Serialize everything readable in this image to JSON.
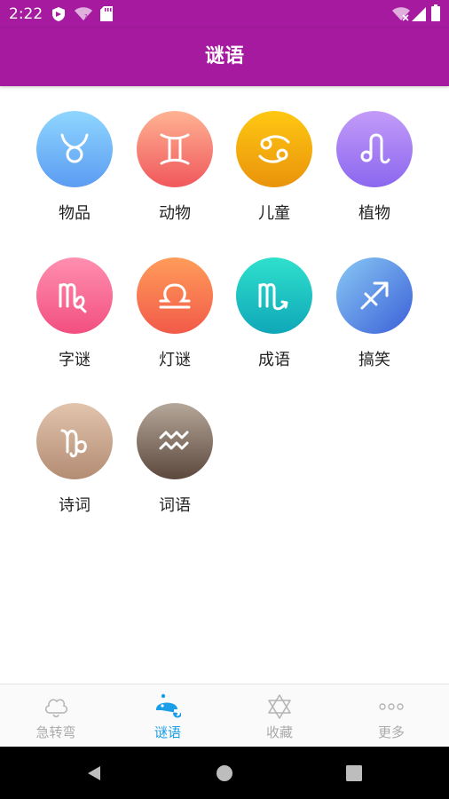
{
  "status_bar": {
    "time": "2:22",
    "left_icons": [
      "shield-icon",
      "wifi-question-icon",
      "sd-card-icon"
    ],
    "right_icons": [
      "wifi-off-icon",
      "signal-icon",
      "battery-icon"
    ]
  },
  "app_bar": {
    "title": "谜语"
  },
  "categories": [
    {
      "label": "物品",
      "icon": "taurus-icon",
      "gradient": [
        "#8fd6ff",
        "#5b9cf2"
      ]
    },
    {
      "label": "动物",
      "icon": "gemini-icon",
      "gradient": [
        "#ffb393",
        "#f0575c"
      ]
    },
    {
      "label": "儿童",
      "icon": "cancer-icon",
      "gradient": [
        "#ffc812",
        "#e9930b"
      ]
    },
    {
      "label": "植物",
      "icon": "leo-icon",
      "gradient": [
        "#c39bf8",
        "#8b67ef"
      ]
    },
    {
      "label": "字谜",
      "icon": "virgo-icon",
      "gradient": [
        "#ff8fb0",
        "#f24f7f"
      ]
    },
    {
      "label": "灯谜",
      "icon": "libra-icon",
      "gradient": [
        "#ff9c5a",
        "#f25a49"
      ]
    },
    {
      "label": "成语",
      "icon": "scorpio-icon",
      "gradient": [
        "#2fe0cc",
        "#0fa7b8"
      ]
    },
    {
      "label": "搞笑",
      "icon": "sagittarius-icon",
      "gradient": [
        "#89c9f4",
        "#3b5fd8"
      ]
    },
    {
      "label": "诗词",
      "icon": "capricorn-icon",
      "gradient": [
        "#e2c4ad",
        "#b38c73"
      ]
    },
    {
      "label": "词语",
      "icon": "aquarius-icon",
      "gradient": [
        "#b5a799",
        "#5c483d"
      ]
    }
  ],
  "bottom_nav": {
    "items": [
      {
        "label": "急转弯",
        "icon": "cloud-icon",
        "active": false
      },
      {
        "label": "谜语",
        "icon": "riddle-icon",
        "active": true
      },
      {
        "label": "收藏",
        "icon": "star-of-david-icon",
        "active": false
      },
      {
        "label": "更多",
        "icon": "more-dots-icon",
        "active": false
      }
    ],
    "active_color": "#1a9ee8",
    "inactive_color": "#aaaaaa"
  },
  "colors": {
    "primary": "#a51a9f"
  },
  "system_nav": {
    "buttons": [
      "back-icon",
      "home-icon",
      "recents-icon"
    ]
  }
}
